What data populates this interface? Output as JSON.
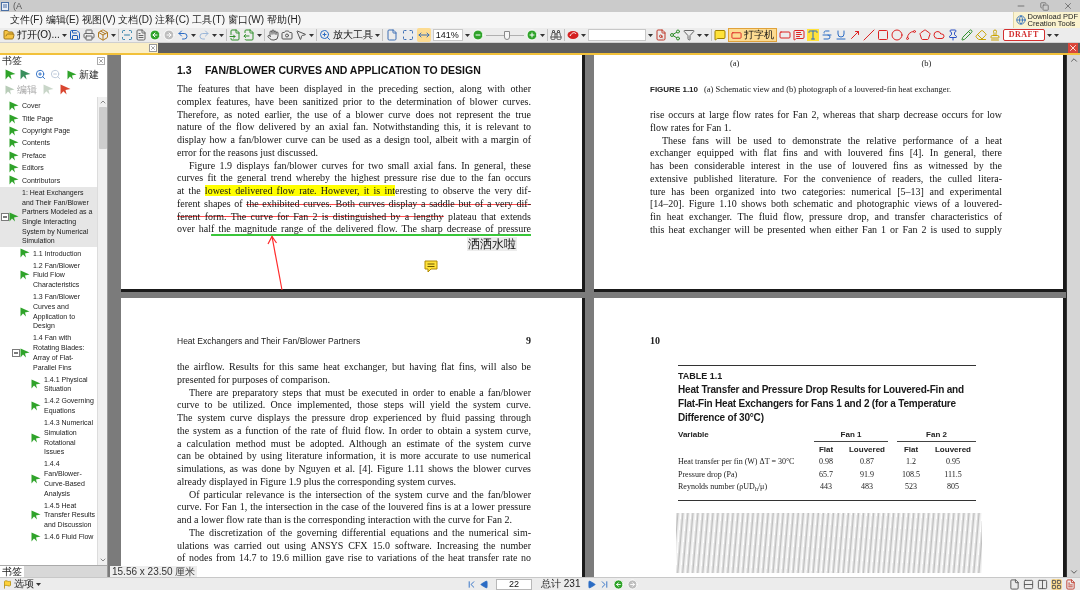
{
  "window": {
    "title": "(A"
  },
  "menu": [
    "文件(F)",
    "编辑(E)",
    "视图(V)",
    "文档(D)",
    "注释(C)",
    "工具(T)",
    "窗口(W)",
    "帮助(H)"
  ],
  "promo": [
    "Download PDF",
    "Creation Tools"
  ],
  "toolbar": {
    "open": "打开(O)...",
    "zoom_tool": "放大工具",
    "zoom_value": "141%",
    "zoom_slider": {
      "level": 0.55
    },
    "fit_modes": [
      {
        "selected": false
      },
      {
        "selected": false
      },
      {
        "selected": true
      }
    ],
    "typewriter": {
      "label": "打字机",
      "selected": true
    },
    "stamp": "DRAFT"
  },
  "sidebar": {
    "title": "书签",
    "tools": [
      {
        "label": "新建",
        "disabled": false
      },
      {
        "label": "编辑",
        "disabled": true
      }
    ],
    "bookmarks": [
      {
        "label": "Cover",
        "selected": false
      },
      {
        "label": "Title Page",
        "selected": false
      },
      {
        "label": "Copyright Page",
        "selected": false
      },
      {
        "label": "Contents",
        "selected": false
      },
      {
        "label": "Preface",
        "selected": false
      },
      {
        "label": "Editors",
        "selected": false
      },
      {
        "label": "Contributors",
        "selected": false
      },
      {
        "label": "1: Heat Exchangers and Their Fan/Blower Partners Modeled as a Single Interacting System by Numerical Simulation",
        "selected": true,
        "expanded": true,
        "children": [
          {
            "label": "1.1 Introduction",
            "selected": false
          },
          {
            "label": "1.2 Fan/Blower Fluid Flow Characteristics",
            "selected": false
          },
          {
            "label": "1.3 Fan/Blower Curves and Application to Design",
            "selected": false
          },
          {
            "label": "1.4 Fan with Rotating Blades: Array of Flat-Parallel Fins",
            "selected": false,
            "expanded": true,
            "children": [
              {
                "label": "1.4.1 Physical Situation",
                "selected": false
              },
              {
                "label": "1.4.2 Governing Equations",
                "selected": false
              },
              {
                "label": "1.4.3 Numerical Simulation Rotational Issues",
                "selected": false
              },
              {
                "label": "1.4.4 Fan/Blower-Curve-Based Analysis",
                "selected": false
              },
              {
                "label": "1.4.5 Heat Transfer Results and Discussion",
                "selected": false
              },
              {
                "label": "1.4.6 Fluid Flow",
                "selected": false
              }
            ]
          }
        ]
      }
    ],
    "tab": "书签"
  },
  "page_1": {
    "heading_number": "1.3",
    "heading": "FAN/BLOWER CURVES AND APPLICATION TO DESIGN",
    "paragraphs": [
      [
        "The features that have been displayed in the preceding section, along with other",
        "complex features, have been sanitized prior to the determination of blower curves.",
        "Therefore, as noted earlier, the use of a blower curve does not represent the true",
        "nature of the flow delivered by an axial fan. Notwithstanding this, it is relevant to",
        "display how a fan/blower curve can be used as a design tool, albeit with a margin of",
        "error for the reasons just discussed."
      ],
      [
        "Figure 1.9 displays fan/blower curves for two small axial fans. In general, these",
        "curves fit the general trend whereby the highest pressure rise due to the fan occurs",
        [
          {
            "text": "at the ",
            "kind": "none"
          },
          {
            "text": "lowest delivered flow rate. However, it is int",
            "kind": "highlight"
          },
          {
            "text": "eresting to observe the very dif-",
            "kind": "none"
          }
        ],
        [
          {
            "text": "ferent shapes of ",
            "kind": "none"
          },
          {
            "text": "the exhibited curves. Both curves display a saddle but of a very dif-",
            "kind": "strike"
          }
        ],
        [
          {
            "text": "ferent form. The curve for Fan 2 is distinguished by a lengthy",
            "kind": "strike"
          },
          {
            "text": " plateau that extends",
            "kind": "none"
          }
        ],
        [
          {
            "text": "over hal",
            "kind": "none"
          },
          {
            "text": "f the magnitude range of the delivered flow. The sharp decrease of pressure",
            "kind": "underline"
          }
        ]
      ]
    ],
    "callout": "洒洒水啦"
  },
  "page_2": {
    "figure_labels": [
      "(a)",
      "(b)"
    ],
    "caption_label": "FIGURE 1.10",
    "caption": "(a) Schematic view and (b) photograph of a louvered-fin heat exchanger.",
    "paragraphs": [
      [
        "rise occurs at large flow rates for Fan 2, whereas that sharp decrease occurs for low",
        "flow rates for Fan 1."
      ],
      [
        "These fans will be used to demonstrate the relative performance of a heat",
        "exchanger equipped with flat fins and with louvered fins [4]. In general, there",
        "has been considerable interest in the use of louvered fins as witnessed by the",
        "extensive published literature. For the convenience of readers, the culled litera-",
        "ture has been organized into two categories: numerical [5–13] and experimental",
        "[14–20]. Figure 1.10 shows both schematic and photographic views of a louvered-",
        "fin heat exchanger. The fluid flow, pressure drop, and transfer characteristics of",
        "this heat exchanger will be presented when either Fan 1 or Fan 2 is used to supply"
      ]
    ]
  },
  "page_3": {
    "running_head": "Heat Exchangers and Their Fan/Blower Partners",
    "page_number": "9",
    "paragraphs": [
      [
        "the airflow. Results for this same heat exchanger, but having flat fins, will also be",
        "presented for purposes of comparison."
      ],
      [
        "There are preparatory steps that must be executed in order to enable a fan/blower",
        "curve to be utilized. Once implemented, those steps will yield the system curve.",
        "The system curve displays the pressure drop experienced by fluid passing through",
        "the system as a function of the rate of fluid flow. In order to obtain a system curve,",
        "a calculation method must be adopted. Although an estimate of the system curve",
        "can be obtained by using literature information, it is more accurate to use numerical",
        "simulations, as was done by Nguyen et al. [4]. Figure 1.11 shows the blower curves",
        "already displayed in Figure 1.9 plus the corresponding system curves."
      ],
      [
        "Of particular relevance is the intersection of the system curve and the fan/blower",
        "curve. For Fan 1, the intersection in the case of the louvered fins is at a lower pressure",
        "and a lower flow rate than is the corresponding interaction with the curve for Fan 2."
      ],
      [
        "The discretization of the governing differential equations and the numerical sim-",
        "ulations was carried out using ANSYS CFX 15.0 software. Increasing the number",
        "of nodes from 14.7 to 19.6 million gave rise to variations of the heat transfer rate no"
      ]
    ]
  },
  "page_4": {
    "page_number": "10",
    "table": {
      "label": "TABLE 1.1",
      "title": "Heat Transfer and Pressure Drop Results for Louvered-Fin and Flat-Fin Heat Exchangers for Fans 1 and 2 (for a Temperature Difference of 30°C)",
      "column_1": "Variable",
      "groups": [
        "Fan 1",
        "Fan 2"
      ],
      "subcolumns": [
        "Flat",
        "Louvered",
        "Flat",
        "Louvered"
      ],
      "rows": [
        {
          "variable": "Heat transfer per fin (W) ΔT = 30°C",
          "values": [
            "0.98",
            "0.87",
            "1.2",
            "0.95"
          ]
        },
        {
          "variable": "Pressure drop (Pa)",
          "values": [
            "65.7",
            "91.9",
            "108.5",
            "111.5"
          ]
        },
        {
          "variable": "Reynolds number (ρUD$_{h}$/μ)",
          "values": [
            "443",
            "483",
            "523",
            "805"
          ]
        }
      ]
    }
  },
  "status_bar": {
    "page_size": "15.56 x 23.50 厘米",
    "options": "选项",
    "page": "22",
    "total": "总计 231",
    "view_modes": [
      {
        "selected": false
      },
      {
        "selected": false
      },
      {
        "selected": false
      },
      {
        "selected": true
      }
    ]
  }
}
